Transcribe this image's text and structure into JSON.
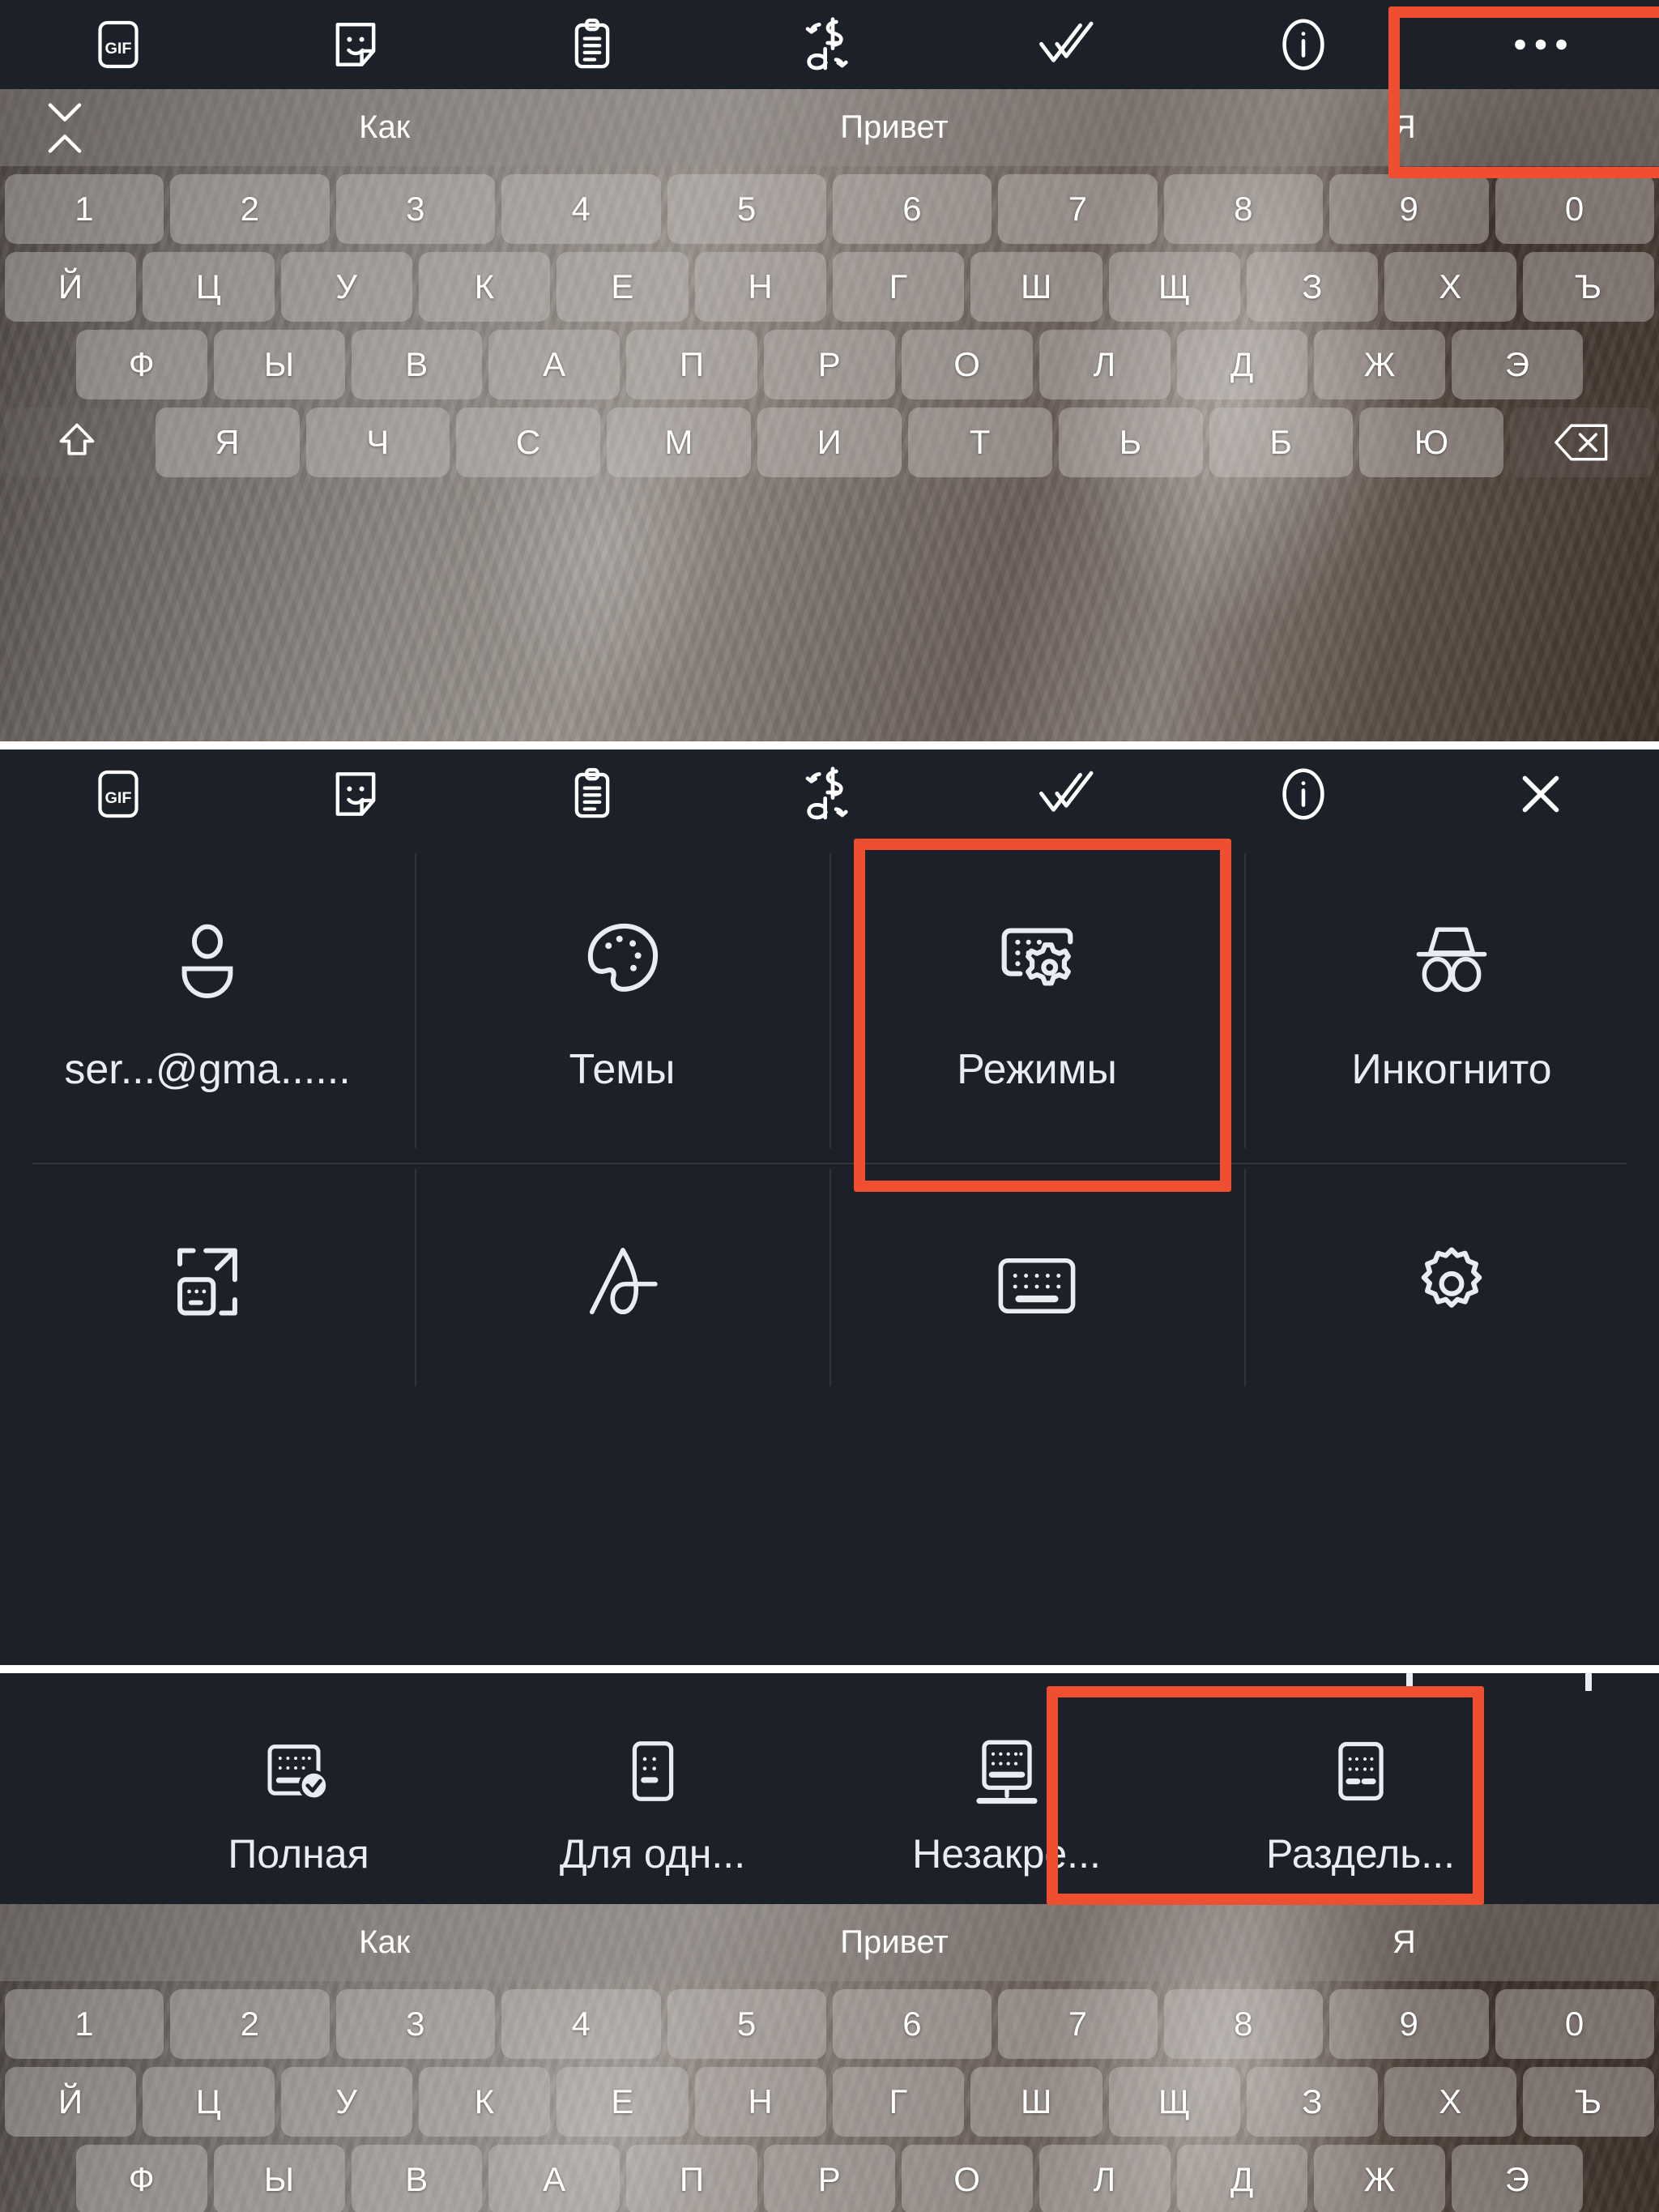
{
  "toolbar": {
    "items": [
      {
        "name": "gif-icon",
        "label": "GIF"
      },
      {
        "name": "sticker-icon",
        "label": "Стикеры"
      },
      {
        "name": "clipboard-icon",
        "label": "Буфер обмена"
      },
      {
        "name": "translate-icon",
        "label": "Перевод"
      },
      {
        "name": "check-icon",
        "label": "Проверка"
      },
      {
        "name": "info-icon",
        "label": "Информация"
      },
      {
        "name": "more-icon",
        "label": "..."
      }
    ],
    "more_glyph": "•••",
    "close_glyph": "×"
  },
  "suggestions": {
    "collapse_label": "Свернуть",
    "words": [
      "Как",
      "Привет",
      "Я"
    ]
  },
  "keyboard": {
    "row_numbers": [
      "1",
      "2",
      "3",
      "4",
      "5",
      "6",
      "7",
      "8",
      "9",
      "0"
    ],
    "row_top": [
      "Й",
      "Ц",
      "У",
      "К",
      "Е",
      "Н",
      "Г",
      "Ш",
      "Щ",
      "З",
      "Х",
      "Ъ"
    ],
    "row_home": [
      "Ф",
      "Ы",
      "В",
      "А",
      "П",
      "Р",
      "О",
      "Л",
      "Д",
      "Ж",
      "Э"
    ],
    "row_bottom": [
      "Я",
      "Ч",
      "С",
      "М",
      "И",
      "Т",
      "Ь",
      "Б",
      "Ю"
    ],
    "shift_label": "Shift",
    "backspace_label": "Backspace"
  },
  "menu": {
    "row1": [
      {
        "label": "ser...@gma......",
        "icon": "account-icon"
      },
      {
        "label": "Темы",
        "icon": "palette-icon"
      },
      {
        "label": "Режимы",
        "icon": "keyboard-modes-icon"
      },
      {
        "label": "Инкогнито",
        "icon": "incognito-icon"
      }
    ],
    "row2": [
      {
        "label": "Изменить размер",
        "icon": "resize-keyboard-icon"
      },
      {
        "label": "Рукописный ввод",
        "icon": "handwriting-icon"
      },
      {
        "label": "Раскладка",
        "icon": "keyboard-layout-icon"
      },
      {
        "label": "Настройки",
        "icon": "settings-gear-icon"
      }
    ]
  },
  "modes": {
    "items": [
      {
        "label": "Полная",
        "icon": "keyboard-full-check-icon",
        "selected": true
      },
      {
        "label": "Для одн...",
        "icon": "keyboard-one-handed-icon",
        "selected": false
      },
      {
        "label": "Незакре...",
        "icon": "keyboard-floating-icon",
        "selected": false
      },
      {
        "label": "Раздель...",
        "icon": "keyboard-split-icon",
        "selected": false
      }
    ]
  },
  "highlights": {
    "color": "#f04e30",
    "boxes": [
      "more-menu-button",
      "modes-menu-item",
      "split-keyboard-mode"
    ]
  },
  "colors": {
    "toolbar_bg": "#1c2028",
    "panel_bg": "#1c2028",
    "text": "#e9ecf1",
    "accent_red": "#f04e30"
  }
}
